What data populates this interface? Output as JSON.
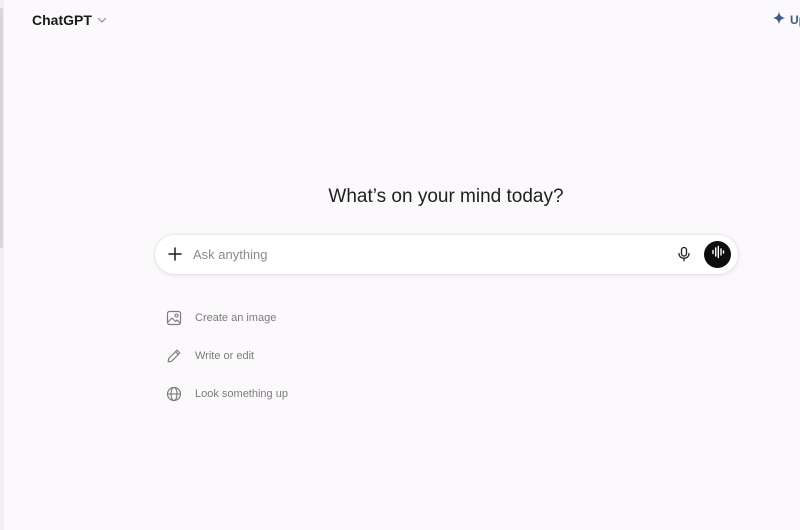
{
  "header": {
    "model_name": "ChatGPT",
    "upgrade_label": "Up"
  },
  "main": {
    "headline": "What’s on your mind today?"
  },
  "composer": {
    "placeholder": "Ask anything",
    "value": ""
  },
  "suggestions": [
    {
      "label": "Create an image",
      "icon": "image-icon"
    },
    {
      "label": "Write or edit",
      "icon": "pencil-icon"
    },
    {
      "label": "Look something up",
      "icon": "globe-icon"
    }
  ],
  "colors": {
    "background": "#fbf9fb",
    "accent": "#3c5a8a",
    "voice_button": "#0d0d0d"
  }
}
